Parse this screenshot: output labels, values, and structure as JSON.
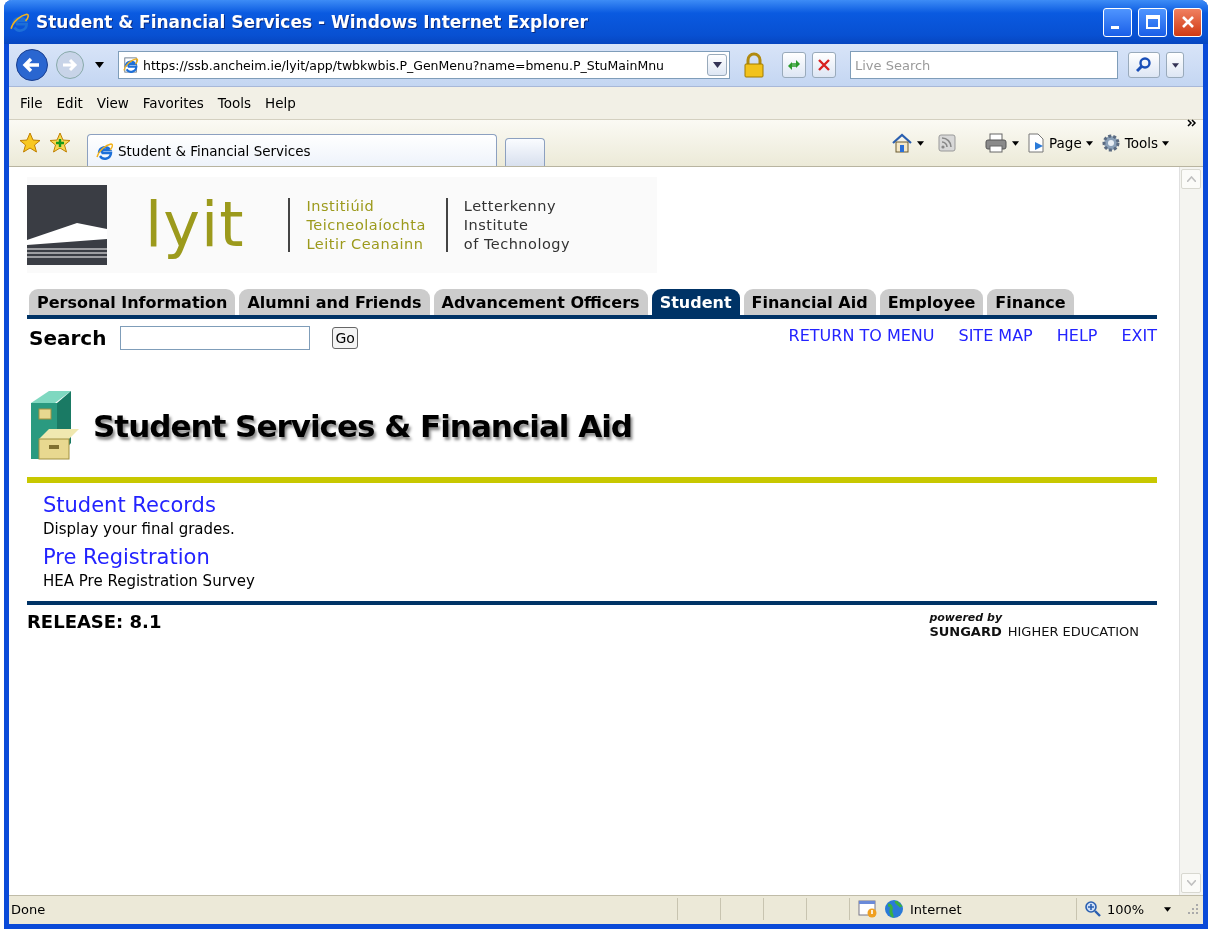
{
  "window": {
    "title": "Student & Financial Services - Windows Internet Explorer"
  },
  "address_bar": {
    "url": "https://ssb.ancheim.ie/lyit/app/twbkwbis.P_GenMenu?name=bmenu.P_StuMainMnu"
  },
  "search_box": {
    "placeholder": "Live Search"
  },
  "menu_bar": [
    "File",
    "Edit",
    "View",
    "Favorites",
    "Tools",
    "Help"
  ],
  "browser_tabs": [
    {
      "label": "Student & Financial Services",
      "selected": true
    }
  ],
  "command_bar": [
    "Page",
    "Tools"
  ],
  "header": {
    "logo_text": "lyit",
    "irish_name": [
      "Institiúid",
      "Teicneolaíochta",
      "Leitir Ceanainn"
    ],
    "english_name": [
      "Letterkenny",
      "Institute",
      "of Technology"
    ]
  },
  "tabs": [
    {
      "label": "Personal Information",
      "selected": false
    },
    {
      "label": "Alumni and Friends",
      "selected": false
    },
    {
      "label": "Advancement Officers",
      "selected": false
    },
    {
      "label": "Student",
      "selected": true
    },
    {
      "label": "Financial Aid",
      "selected": false
    },
    {
      "label": "Employee",
      "selected": false
    },
    {
      "label": "Finance",
      "selected": false
    }
  ],
  "search": {
    "label": "Search",
    "button": "Go"
  },
  "nav_links": [
    "RETURN TO MENU",
    "SITE MAP",
    "HELP",
    "EXIT"
  ],
  "page_title": "Student Services & Financial Aid",
  "menu_items": [
    {
      "title": "Student Records",
      "description": "Display your final grades."
    },
    {
      "title": "Pre Registration",
      "description": "HEA Pre Registration Survey"
    }
  ],
  "footer": {
    "release": "RELEASE: 8.1",
    "powered_by": "powered by",
    "vendor": "SUNGARD",
    "vendor_suffix": "HIGHER EDUCATION"
  },
  "status_bar": {
    "text": "Done",
    "zone": "Internet",
    "zoom": "100%"
  }
}
